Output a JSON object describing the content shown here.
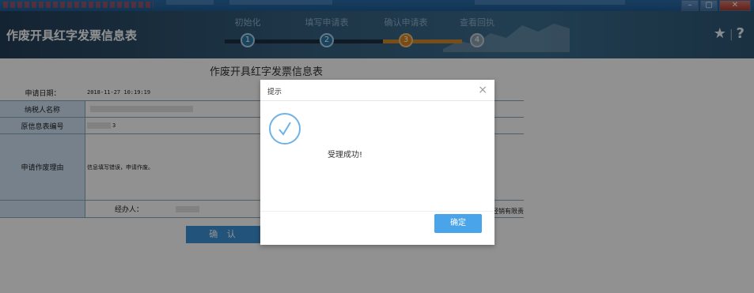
{
  "window": {
    "buttons": [
      "–",
      "▢",
      "✕"
    ]
  },
  "header": {
    "title": "作废开具红字发票信息表",
    "steps": [
      {
        "num": "1",
        "label": "初始化"
      },
      {
        "num": "2",
        "label": "填写申请表"
      },
      {
        "num": "3",
        "label": "确认申请表"
      },
      {
        "num": "4",
        "label": "查看回执"
      }
    ],
    "current_step": 3,
    "icons": [
      "star-icon",
      "help-icon"
    ]
  },
  "form": {
    "title": "作废开具红字发票信息表",
    "apply_date_label": "申请日期：",
    "apply_date_value": "2018-11-27 10:19:19",
    "taxpayer_label": "纳税人名称",
    "info_no_label": "原信息表编号",
    "info_no_value": "3",
    "reason_label": "申请作废理由",
    "reason_value": "信息填写错误，申请作废。",
    "operator_label": "经办人：",
    "right_fragment": "经销有限责",
    "confirm_label": "确 认"
  },
  "modal": {
    "title": "提示",
    "close": "×",
    "message": "受理成功!",
    "ok_label": "确定",
    "icon": "check-circle-icon"
  },
  "colors": {
    "accent": "#4aa4ea",
    "banner": "#35607f",
    "current_step": "#d8851f"
  }
}
